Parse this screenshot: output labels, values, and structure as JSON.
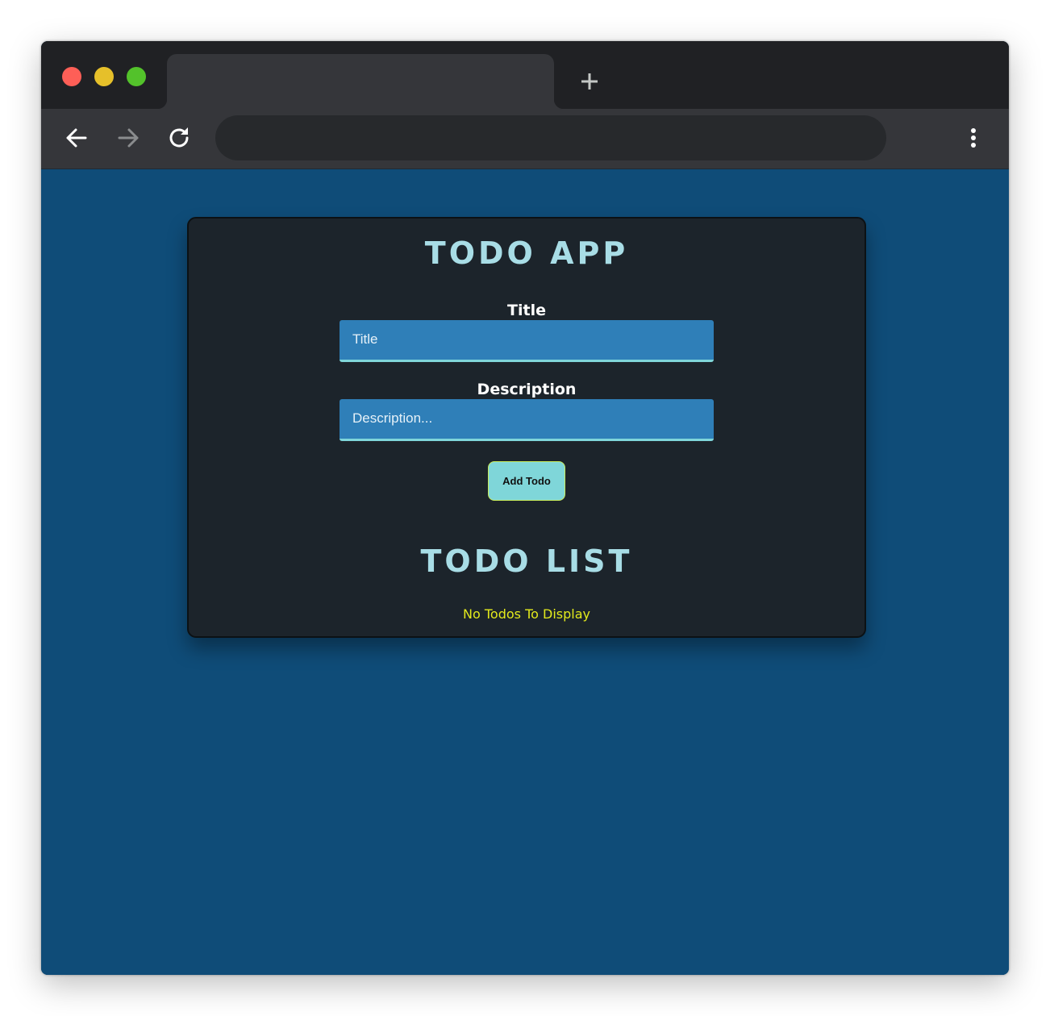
{
  "browser": {
    "tab_title": "",
    "address": "",
    "traffic_lights": {
      "close": "#fe5f57",
      "minimize": "#e6c02a",
      "zoom": "#53c22b"
    },
    "icons": {
      "new_tab": "plus-icon",
      "back": "arrow-left-icon",
      "forward": "arrow-right-icon",
      "reload": "reload-icon",
      "menu": "kebab-menu-icon"
    }
  },
  "app": {
    "heading": "TODO APP",
    "title_label": "Title",
    "title_placeholder": "Title",
    "title_value": "",
    "description_label": "Description",
    "description_placeholder": "Description...",
    "description_value": "",
    "add_button_label": "Add Todo",
    "list_heading": "TODO LIST",
    "empty_message": "No Todos To Display"
  },
  "colors": {
    "page_background": "#0f4c78",
    "card_background": "#1c242b",
    "heading": "#a8dde6",
    "input_background": "#2f7fb8",
    "input_underline": "#7fd6da",
    "button_background": "#7fd6d9",
    "empty_message": "#e3ea1c"
  }
}
